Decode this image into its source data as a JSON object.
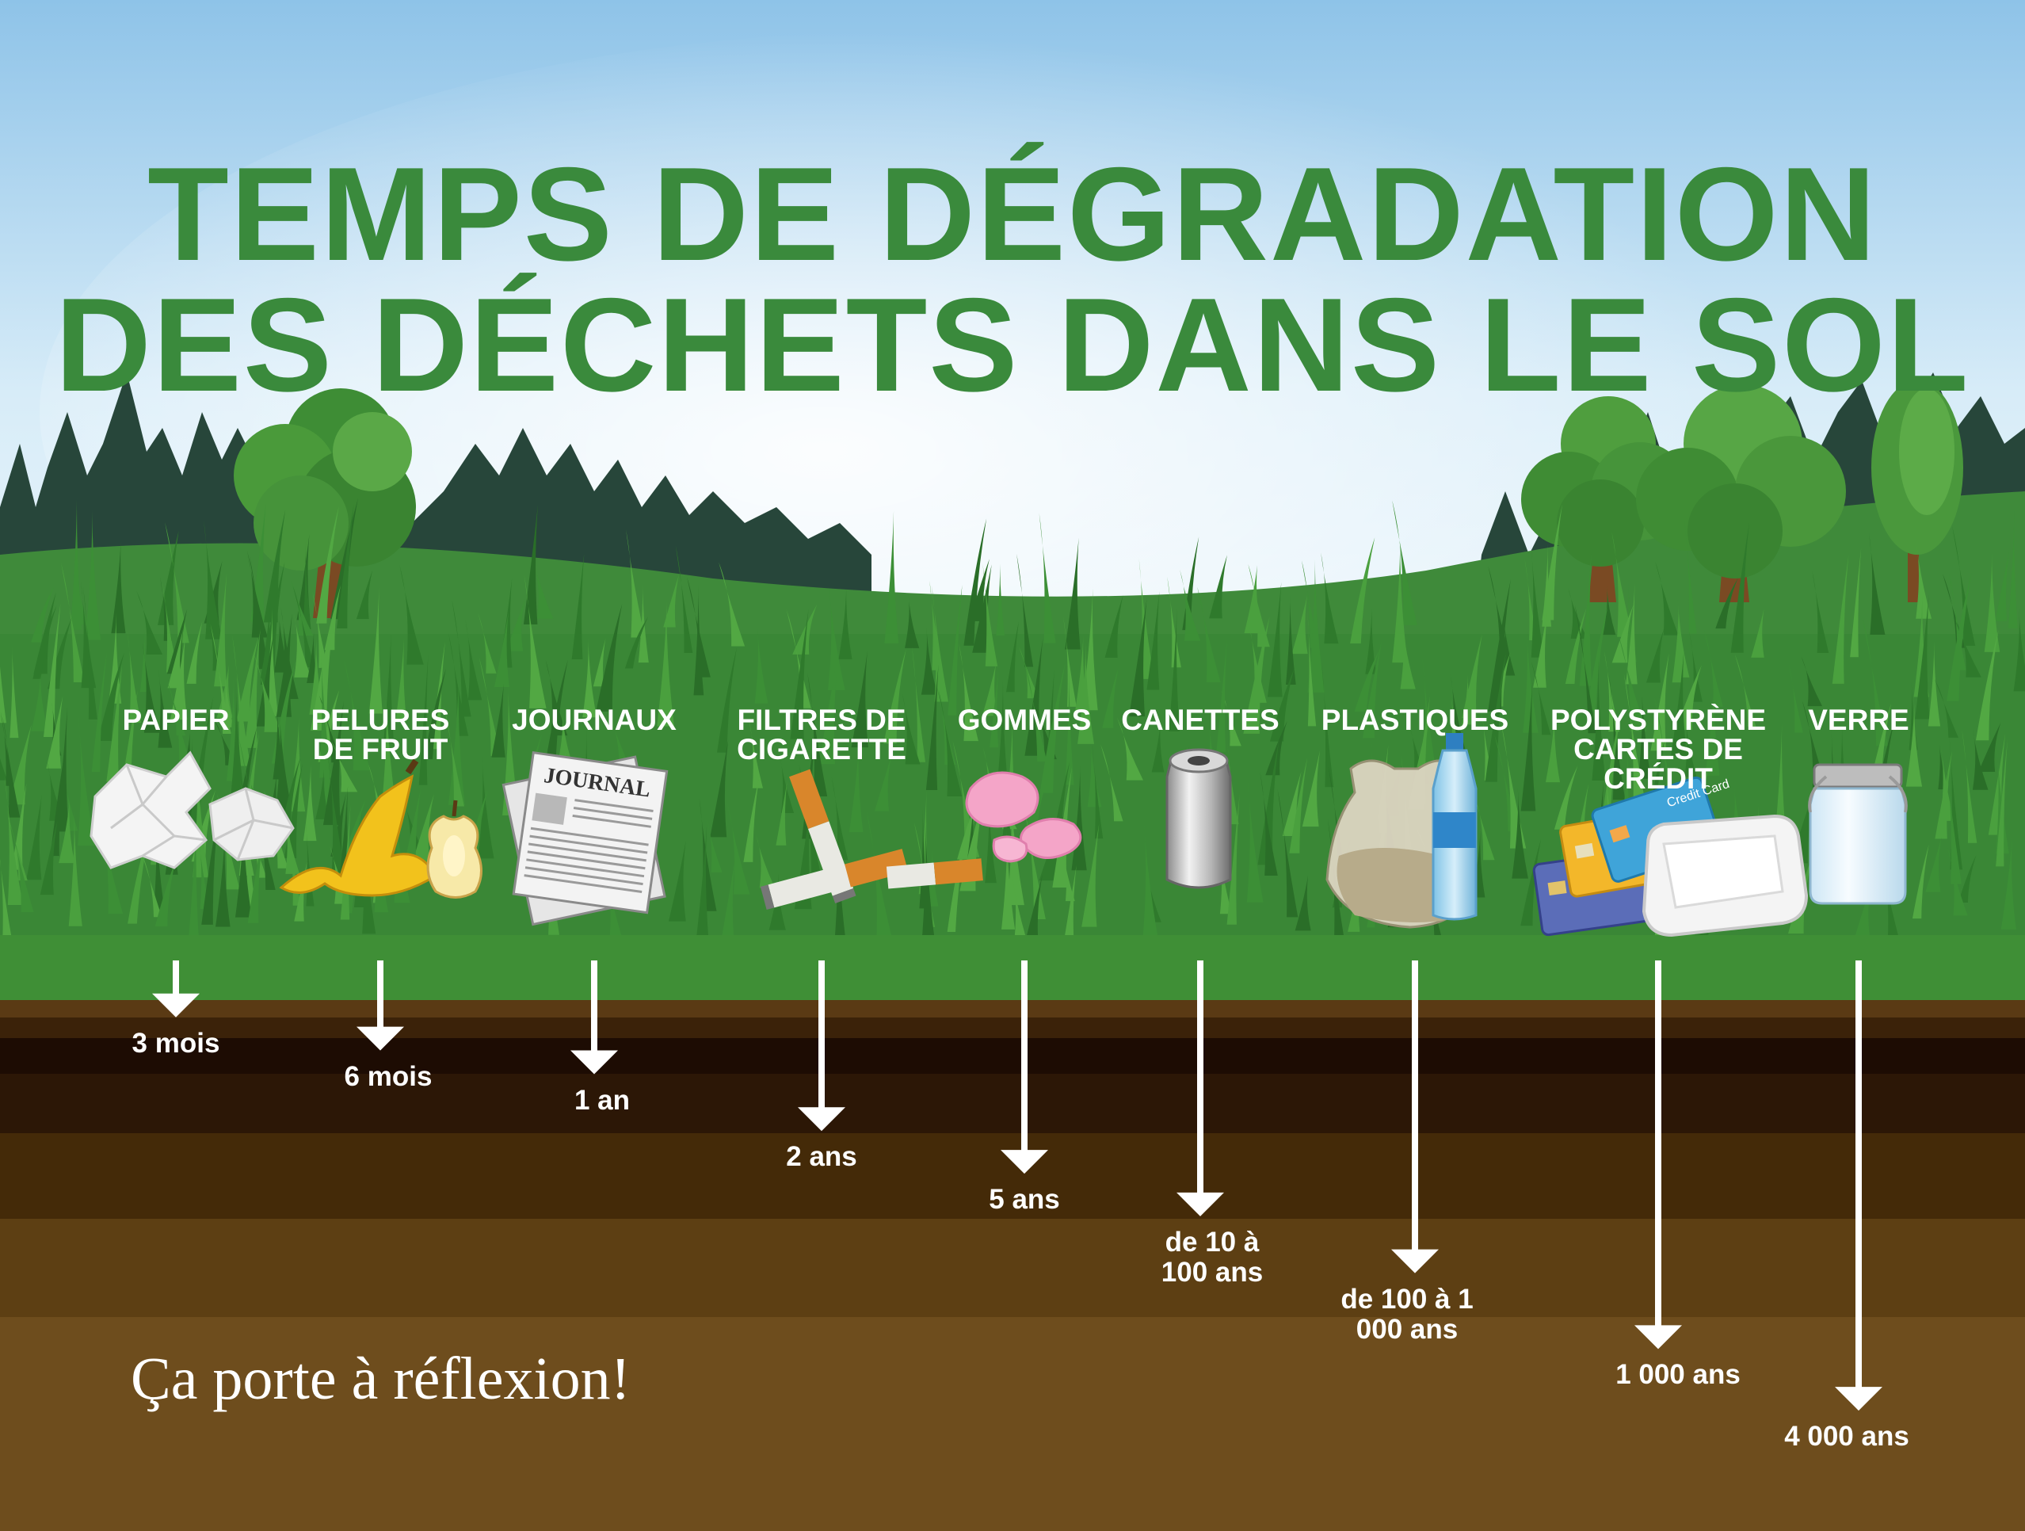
{
  "title": {
    "line1": "TEMPS DE DÉGRADATION",
    "line2": "DES DÉCHETS DANS LE SOL"
  },
  "items": [
    {
      "label": "PAPIER",
      "time": "3 mois",
      "icon": "crumpled-paper-icon",
      "arrow_level": 0.12
    },
    {
      "label": "PELURES DE FRUIT",
      "time": "6 mois",
      "icon": "banana-peel-icon",
      "arrow_level": 0.19
    },
    {
      "label": "JOURNAUX",
      "time": "1 an",
      "icon": "newspaper-icon",
      "arrow_level": 0.24
    },
    {
      "label": "FILTRES DE CIGARETTE",
      "time": "2 ans",
      "icon": "cigarette-butt-icon",
      "arrow_level": 0.36
    },
    {
      "label": "GOMMES",
      "time": "5 ans",
      "icon": "chewing-gum-icon",
      "arrow_level": 0.45
    },
    {
      "label": "CANETTES",
      "time": "de 10 à 100 ans",
      "icon": "soda-can-icon",
      "arrow_level": 0.54
    },
    {
      "label": "PLASTIQUES",
      "time": "de 100 à 1 000 ans",
      "icon": "plastic-bag-bottle-icon",
      "arrow_level": 0.66
    },
    {
      "label": "POLYSTYRÈNE CARTES DE CRÉDIT",
      "time": "1 000 ans",
      "icon": "credit-cards-foam-tray-icon",
      "arrow_level": 0.82
    },
    {
      "label": "VERRE",
      "time": "4 000 ans",
      "icon": "glass-jar-icon",
      "arrow_level": 0.95
    }
  ],
  "card_text": "Credit Card",
  "newspaper_text": "JOURNAL",
  "tagline": "Ça porte à réflexion!",
  "colors": {
    "title": "#3a8a3c",
    "sky_top": "#9ccbe8",
    "grass": "#3e8a3a",
    "soil_dark": "#1e0d05",
    "soil_light": "#6e4d1c"
  }
}
